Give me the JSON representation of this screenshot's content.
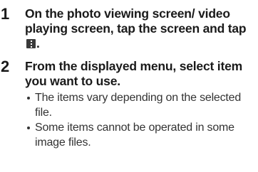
{
  "steps": [
    {
      "number": "1",
      "text_before_icon": "On the photo viewing screen/ video playing screen, tap the screen and tap ",
      "icon": "menu-icon",
      "text_after_icon": "."
    },
    {
      "number": "2",
      "text": "From the displayed menu, select item you want to use.",
      "bullets": [
        "The items vary depending on the selected file.",
        "Some items cannot be operated in some image files."
      ]
    }
  ]
}
